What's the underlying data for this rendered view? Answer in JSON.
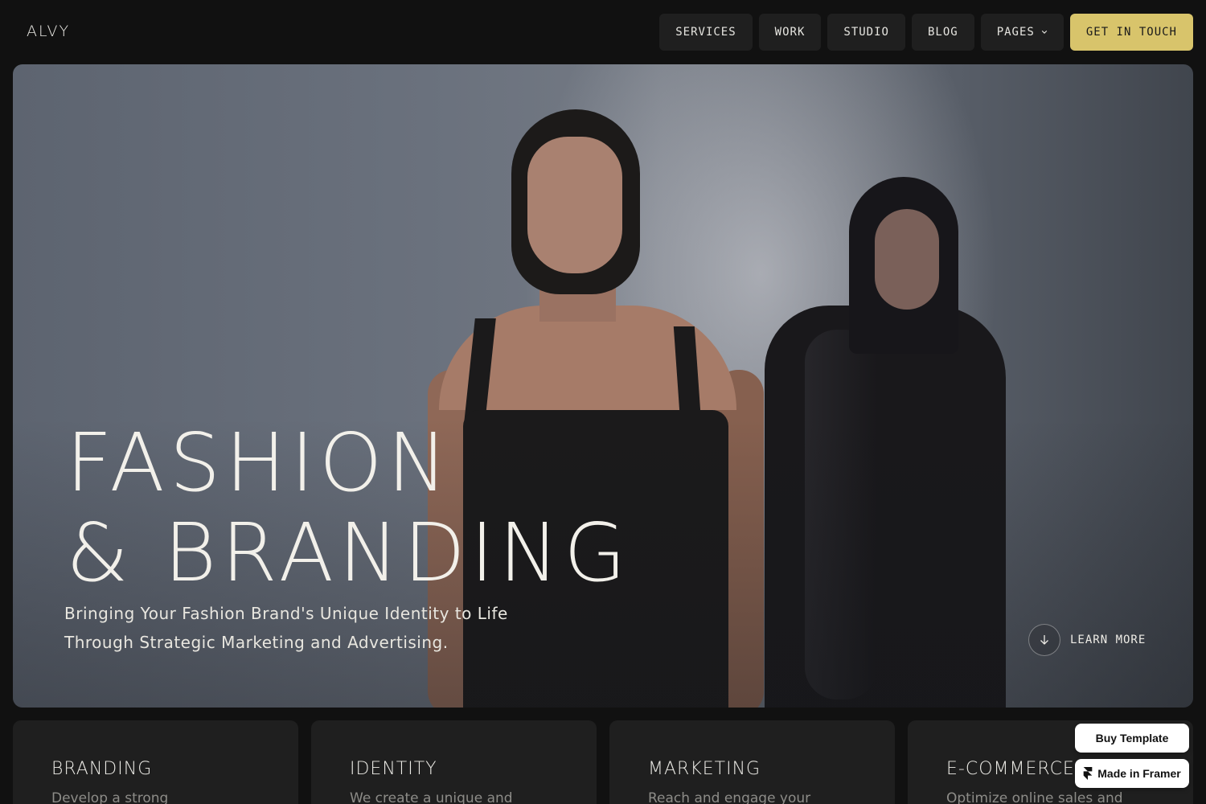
{
  "header": {
    "logo": "ALVY",
    "nav": [
      {
        "label": "SERVICES"
      },
      {
        "label": "WORK"
      },
      {
        "label": "STUDIO"
      },
      {
        "label": "BLOG"
      },
      {
        "label": "PAGES",
        "icon": "chevron-down-icon"
      }
    ],
    "cta": "GET IN TOUCH",
    "cta_color": "#d8c46b"
  },
  "hero": {
    "title_line1": "FASHION",
    "title_line2": "& BRANDING",
    "subtitle_line1": "Bringing Your Fashion Brand's Unique Identity to Life",
    "subtitle_line2": "Through Strategic Marketing and Advertising.",
    "learn_more": "LEARN MORE",
    "learn_more_icon": "arrow-down-icon"
  },
  "services": [
    {
      "title": "BRANDING",
      "desc": "Develop a strong"
    },
    {
      "title": "IDENTITY",
      "desc": "We create a unique and"
    },
    {
      "title": "MARKETING",
      "desc": "Reach and engage your"
    },
    {
      "title": "E-COMMERCE",
      "desc": "Optimize online sales and"
    }
  ],
  "badges": {
    "buy": "Buy Template",
    "framer": "Made in Framer",
    "framer_icon": "framer-logo-icon"
  }
}
